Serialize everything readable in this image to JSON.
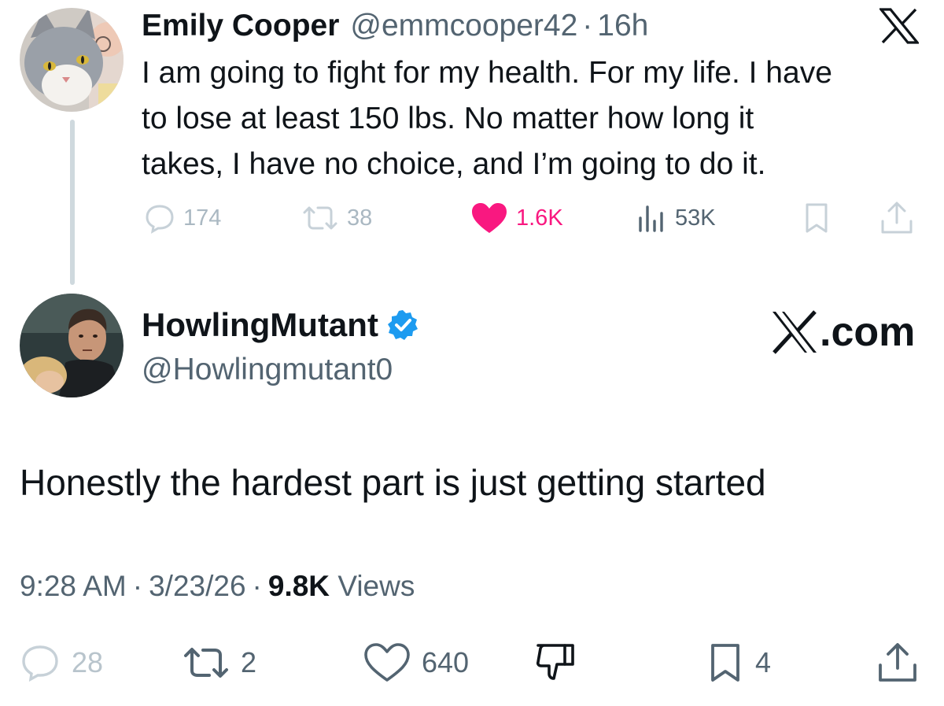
{
  "colors": {
    "text_primary": "#0f1419",
    "text_secondary": "#536471",
    "icon_muted": "#aab8c2",
    "like_pink": "#f91880",
    "verified_blue": "#1d9bf0",
    "thread_line": "#cfd9de"
  },
  "parent_tweet": {
    "name": "Emily Cooper",
    "handle": "@emmcooper42",
    "separator": "·",
    "time": "16h",
    "avatar_icon": "cat-avatar",
    "brand_icon": "x-logo-icon",
    "text_lines": [
      "I am going to fight for my health. For my life. I have",
      "to lose at least 150 lbs. No matter how long it",
      "takes, I have no choice, and I’m going to do it."
    ],
    "actions": {
      "replies": "174",
      "reposts": "38",
      "likes": "1.6K",
      "views": "53K"
    }
  },
  "main_tweet": {
    "name": "HowlingMutant",
    "handle": "@Howlingmutant0",
    "verified": true,
    "avatar_icon": "man-avatar",
    "brand": {
      "x_text": "X",
      "domain_text": ".com"
    },
    "text": "Honestly the hardest part is just getting started",
    "meta": {
      "time": "9:28 AM",
      "separator": "·",
      "date": "3/23/26",
      "views_count": "9.8K",
      "views_label": "Views"
    },
    "actions": {
      "replies": "28",
      "reposts": "2",
      "likes": "640",
      "bookmarks": "4"
    }
  }
}
